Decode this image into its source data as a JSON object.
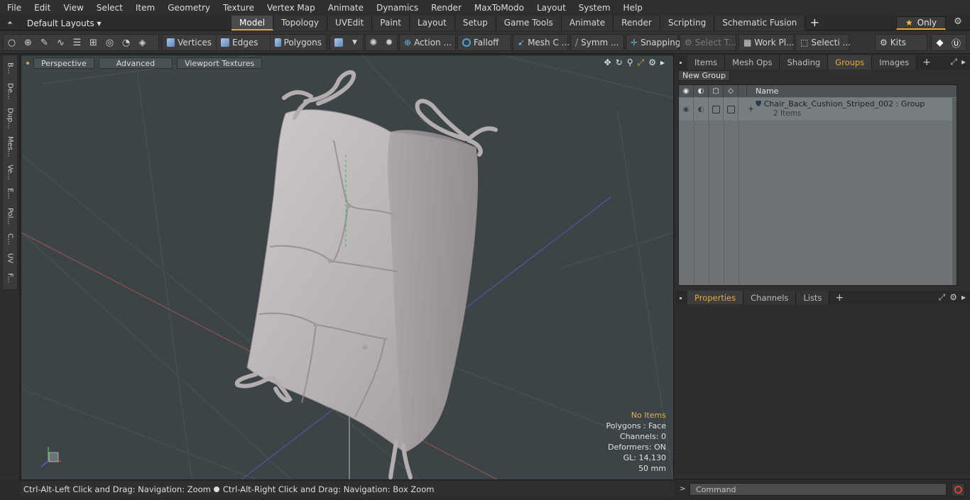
{
  "menu": [
    "File",
    "Edit",
    "View",
    "Select",
    "Item",
    "Geometry",
    "Texture",
    "Vertex Map",
    "Animate",
    "Dynamics",
    "Render",
    "MaxToModo",
    "Layout",
    "System",
    "Help"
  ],
  "layout_select": "Default Layouts ▾",
  "mode_tabs": [
    "Model",
    "Topology",
    "UVEdit",
    "Paint",
    "Layout",
    "Setup",
    "Game Tools",
    "Animate",
    "Render",
    "Scripting",
    "Schematic Fusion"
  ],
  "only_label": "Only",
  "toolbar": {
    "vertices": "Vertices",
    "edges": "Edges",
    "polygons": "Polygons",
    "action": "Action ...",
    "falloff": "Falloff",
    "mesh_c": "Mesh C ...",
    "symm": "Symm ...",
    "snapping": "Snapping",
    "select_t": "Select T...",
    "work_pl": "Work Pl...",
    "selecti": "Selecti ...",
    "kits": "Kits"
  },
  "left_tabs": [
    "B...",
    "De...",
    "Dup...",
    "Mes...",
    "Ve...",
    "E...",
    "Pol...",
    "C...",
    "UV",
    "F..."
  ],
  "viewport": {
    "perspective": "Perspective",
    "advanced": "Advanced",
    "textures": "Viewport Textures",
    "info": {
      "no_items": "No Items",
      "polygons": "Polygons : Face",
      "channels": "Channels: 0",
      "deformers": "Deformers: ON",
      "gl": "GL: 14,130",
      "scale": "50 mm"
    }
  },
  "status": {
    "left": "Ctrl-Alt-Left Click and Drag: Navigation: Zoom",
    "right": "Ctrl-Alt-Right Click and Drag: Navigation: Box Zoom"
  },
  "right_top_tabs": [
    "Items",
    "Mesh Ops",
    "Shading",
    "Groups",
    "Images"
  ],
  "active_top_tab": "Groups",
  "new_group": "New Group",
  "groups_list": {
    "name_header": "Name",
    "row_name": "Chair_Back_Cushion_Striped_002 : Group",
    "row_count": "2 Items"
  },
  "right_bottom_tabs": [
    "Properties",
    "Channels",
    "Lists"
  ],
  "command_placeholder": "Command",
  "colors": {
    "accent": "#e5a93b",
    "viewport_bg": "#3d4448",
    "cushion": "#b9b3b6"
  }
}
